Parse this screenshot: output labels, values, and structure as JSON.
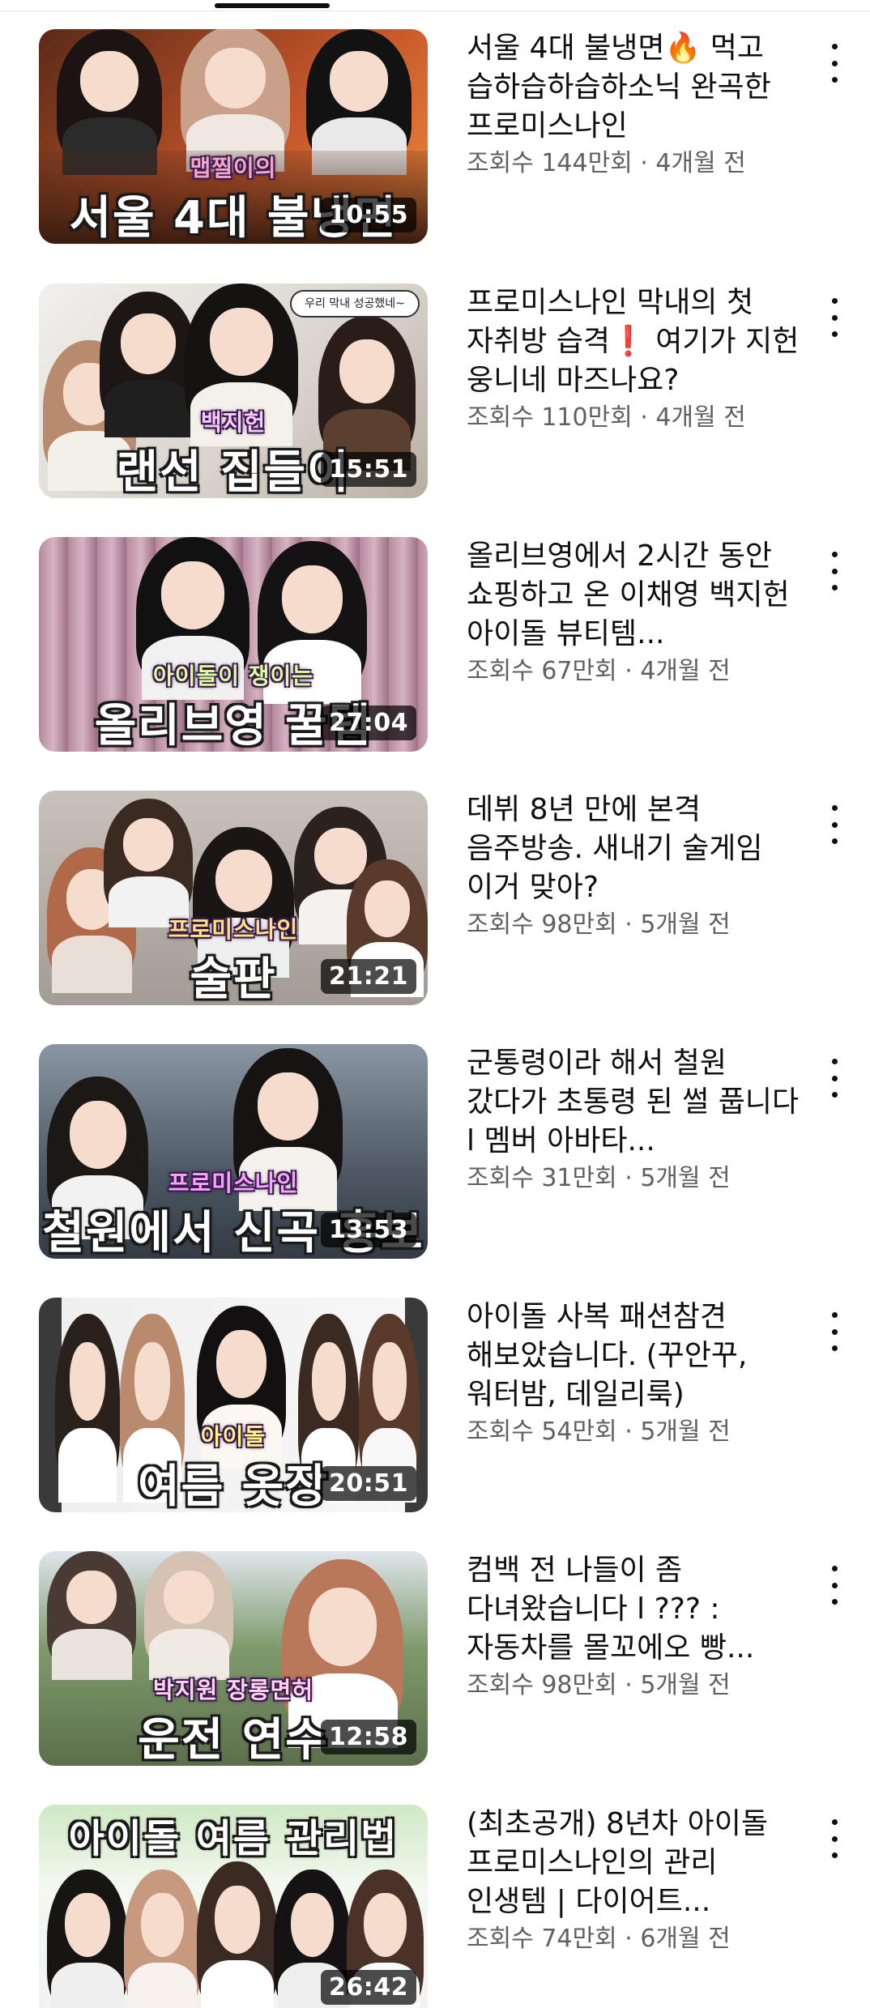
{
  "videos": [
    {
      "title": "서울 4대 불냉면🔥 먹고 습하습하습하소닉 완곡한 프로미스나인",
      "views": "조회수 144만회",
      "age": "4개월 전",
      "duration": "10:55",
      "thumb_sub": "맵찔이의",
      "thumb_main": "서울 4대 불냉면",
      "bg_colors": [
        "#7a3a1f",
        "#d96a2a"
      ]
    },
    {
      "title": "프로미스나인 막내의 첫 자취방 습격❗ 여기가 지헌 웅니네 마즈나요?",
      "views": "조회수 110만회",
      "age": "4개월 전",
      "duration": "15:51",
      "thumb_sub": "백지헌",
      "thumb_main": "랜선 집들이",
      "bubble": "우리 막내 성공했네~",
      "bg_colors": [
        "#e8e6e3",
        "#c8c2bb"
      ]
    },
    {
      "title": "올리브영에서 2시간 동안 쇼핑하고 온 이채영 백지헌 아이돌 뷰티템...",
      "views": "조회수 67만회",
      "age": "4개월 전",
      "duration": "27:04",
      "thumb_sub": "아이돌이 쟁이는",
      "thumb_main": "올리브영 꿀템",
      "bg_colors": [
        "#c9a2b4",
        "#e2c4cf"
      ]
    },
    {
      "title": "데뷔 8년 만에 본격 음주방송. 새내기 술게임 이거 맞아?",
      "views": "조회수 98만회",
      "age": "5개월 전",
      "duration": "21:21",
      "thumb_sub": "프로미스나인",
      "thumb_main": "술판",
      "bg_colors": [
        "#b8b2ac",
        "#d6d0c8"
      ]
    },
    {
      "title": "군통령이라 해서 철원 갔다가 초통령 된 썰 풉니다 l 멤버 아바타...",
      "views": "조회수 31만회",
      "age": "5개월 전",
      "duration": "13:53",
      "thumb_sub": "프로미스나인",
      "thumb_main": "철원에서 신곡 홍보",
      "bg_colors": [
        "#4a5562",
        "#7a8592"
      ]
    },
    {
      "title": "아이돌 사복 패션참견 해보았습니다. (꾸안꾸, 워터밤, 데일리룩)",
      "views": "조회수 54만회",
      "age": "5개월 전",
      "duration": "20:51",
      "thumb_sub": "아이돌",
      "thumb_main": "여름 옷장",
      "bg_colors": [
        "#e6e6e6",
        "#f4f4f4"
      ]
    },
    {
      "title": "컴백 전 나들이 좀 다녀왔습니다 l ??? : 자동차를 몰꼬에오 빵...",
      "views": "조회수 98만회",
      "age": "5개월 전",
      "duration": "12:58",
      "thumb_sub": "박지원 장롱면허",
      "thumb_main": "운전 연수",
      "bg_colors": [
        "#6f8a5c",
        "#9fb78c"
      ]
    },
    {
      "title": "(최초공개) 8년차 아이돌 프로미스나인의 관리 인생템 | 다이어트...",
      "views": "조회수 74만회",
      "age": "6개월 전",
      "duration": "26:42",
      "thumb_sub": "",
      "thumb_main": "아이돌 여름 관리법",
      "bg_colors": [
        "#d7ecd0",
        "#f1f7ee"
      ]
    }
  ],
  "meta_separator": " · "
}
